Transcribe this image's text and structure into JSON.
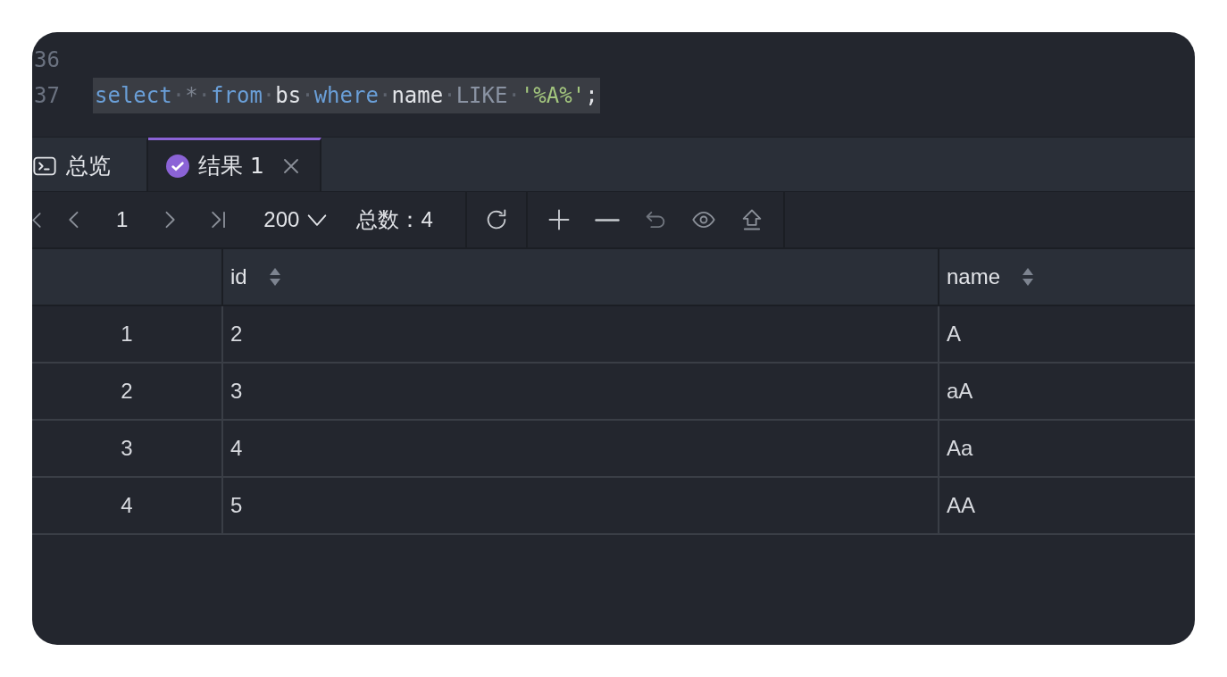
{
  "editor": {
    "lines": [
      {
        "number": "36"
      },
      {
        "number": "37",
        "highlighted": true,
        "tokens": [
          {
            "kind": "keyword",
            "text": "select"
          },
          {
            "kind": "space",
            "text": "·"
          },
          {
            "kind": "operator",
            "text": "*"
          },
          {
            "kind": "space",
            "text": "·"
          },
          {
            "kind": "keyword",
            "text": "from"
          },
          {
            "kind": "space",
            "text": "·"
          },
          {
            "kind": "plain",
            "text": "bs"
          },
          {
            "kind": "space",
            "text": "·"
          },
          {
            "kind": "keyword",
            "text": "where"
          },
          {
            "kind": "space",
            "text": "·"
          },
          {
            "kind": "plain",
            "text": "name"
          },
          {
            "kind": "space",
            "text": "·"
          },
          {
            "kind": "function",
            "text": "LIKE"
          },
          {
            "kind": "space",
            "text": "·"
          },
          {
            "kind": "string",
            "text": "'%A%'"
          },
          {
            "kind": "plain",
            "text": ";"
          }
        ]
      }
    ]
  },
  "tabs": [
    {
      "label": "总览",
      "kind": "console",
      "selected": false,
      "closable": false
    },
    {
      "label": "结果 1",
      "kind": "result",
      "selected": true,
      "closable": true
    }
  ],
  "toolbar": {
    "page": "1",
    "page_size": "200",
    "total": "总数：4"
  },
  "table": {
    "columns": [
      "",
      "id",
      "name"
    ],
    "rows": [
      [
        "1",
        "2",
        "A"
      ],
      [
        "2",
        "3",
        "aA"
      ],
      [
        "3",
        "4",
        "Aa"
      ],
      [
        "4",
        "5",
        "AA"
      ]
    ]
  }
}
